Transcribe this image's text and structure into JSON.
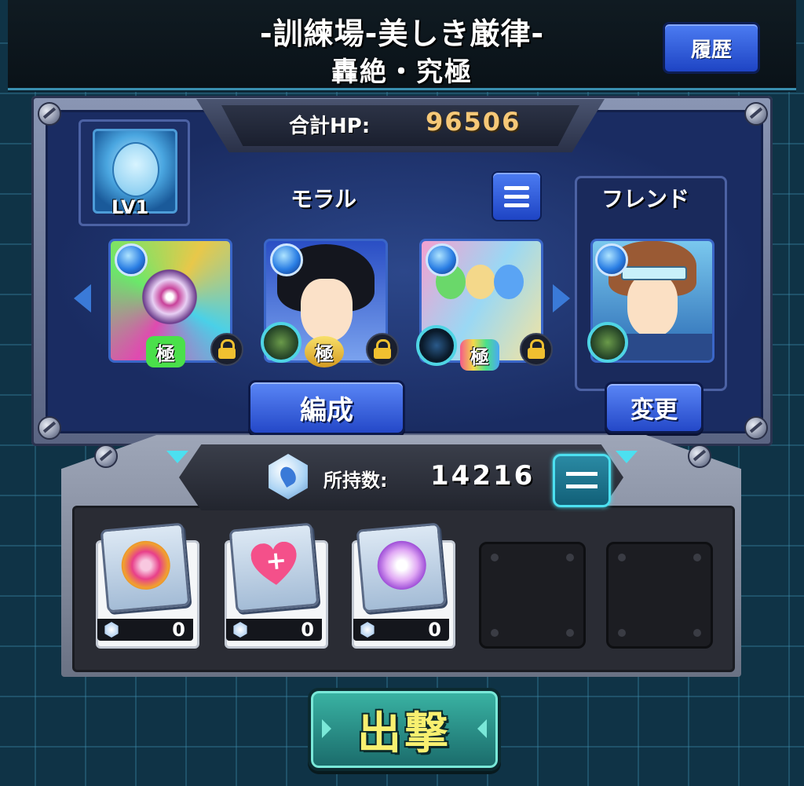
{
  "header": {
    "title": "-訓練場-美しき厳律-",
    "subtitle": "轟絶・究極",
    "history_label": "履歴"
  },
  "party": {
    "hp_label": "合計HP:",
    "hp_value": "96506",
    "leader_level": "LV1",
    "team_name": "モラル",
    "friend_label": "フレンド",
    "edit_label": "編成",
    "change_label": "変更",
    "kiwame_label": "極"
  },
  "items": {
    "owned_label": "所持数:",
    "owned_value": "14216",
    "slots": [
      {
        "count": "0"
      },
      {
        "count": "0"
      },
      {
        "count": "0"
      }
    ]
  },
  "sortie_label": "出撃",
  "colors": {
    "accent_blue": "#2448c8",
    "hp_value": "#f6c878",
    "sortie_text": "#f8f070",
    "cyan_highlight": "#4ce0f0"
  }
}
